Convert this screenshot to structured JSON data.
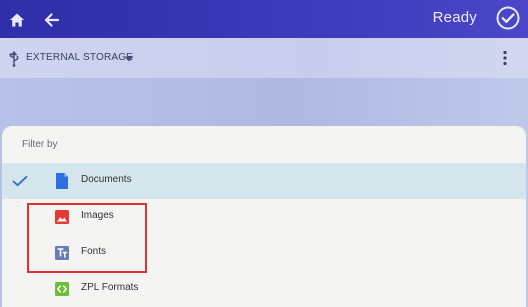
{
  "topbar": {
    "status": "Ready"
  },
  "storage": {
    "label": "EXTERNAL STORAGE"
  },
  "filter": {
    "title": "Filter by",
    "items": [
      {
        "label": "Documents",
        "icon": "document-icon",
        "selected": true
      },
      {
        "label": "Images",
        "icon": "image-icon",
        "selected": false
      },
      {
        "label": "Fonts",
        "icon": "font-icon",
        "selected": false
      },
      {
        "label": "ZPL Formats",
        "icon": "code-icon",
        "selected": false
      }
    ]
  },
  "colors": {
    "topbar": "#3736b4",
    "accent_blue": "#2e6fde",
    "selected_row": "#d4e6ec",
    "highlight_box": "#e0302f",
    "ready_check": "#e8e8ff",
    "documents_icon": "#2f6ee0",
    "images_icon": "#e53935",
    "fonts_icon": "#6a7bb3",
    "zpl_icon": "#6cbf3a"
  }
}
